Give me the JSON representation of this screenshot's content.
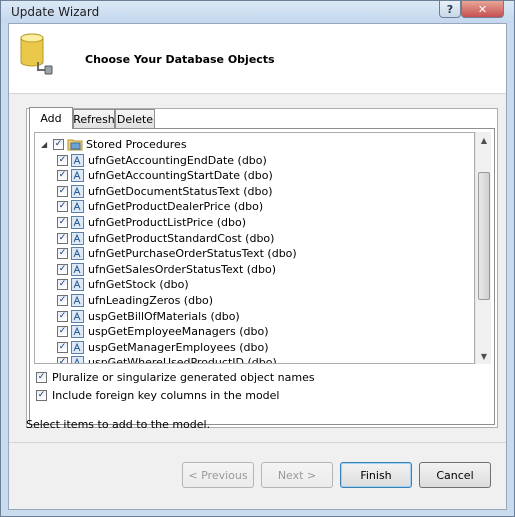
{
  "window": {
    "title": "Update Wizard",
    "help_label": "?",
    "close_label": "✕"
  },
  "header": {
    "title": "Choose Your Database Objects"
  },
  "tabs": [
    {
      "label": "Add"
    },
    {
      "label": "Refresh"
    },
    {
      "label": "Delete"
    }
  ],
  "tree": {
    "root": {
      "label": "Stored Procedures",
      "expander": "◢",
      "checked": true
    },
    "items": [
      {
        "label": "ufnGetAccountingEndDate (dbo)"
      },
      {
        "label": "ufnGetAccountingStartDate (dbo)"
      },
      {
        "label": "ufnGetDocumentStatusText (dbo)"
      },
      {
        "label": "ufnGetProductDealerPrice (dbo)"
      },
      {
        "label": "ufnGetProductListPrice (dbo)"
      },
      {
        "label": "ufnGetProductStandardCost (dbo)"
      },
      {
        "label": "ufnGetPurchaseOrderStatusText (dbo)"
      },
      {
        "label": "ufnGetSalesOrderStatusText (dbo)"
      },
      {
        "label": "ufnGetStock (dbo)"
      },
      {
        "label": "ufnLeadingZeros (dbo)"
      },
      {
        "label": "uspGetBillOfMaterials (dbo)"
      },
      {
        "label": "uspGetEmployeeManagers (dbo)"
      },
      {
        "label": "uspGetManagerEmployees (dbo)"
      },
      {
        "label": "uspGetWhereUsedProductID (dbo)"
      }
    ]
  },
  "options": {
    "pluralize": {
      "label": "Pluralize or singularize generated object names",
      "checked": true
    },
    "foreign_keys": {
      "label": "Include foreign key columns in the model",
      "checked": true
    }
  },
  "status": "Select items to add to the model.",
  "buttons": {
    "previous": "< Previous",
    "next": "Next >",
    "finish": "Finish",
    "cancel": "Cancel"
  },
  "glyphs": {
    "check": "✓",
    "scroll_up": "▲",
    "scroll_down": "▼"
  }
}
